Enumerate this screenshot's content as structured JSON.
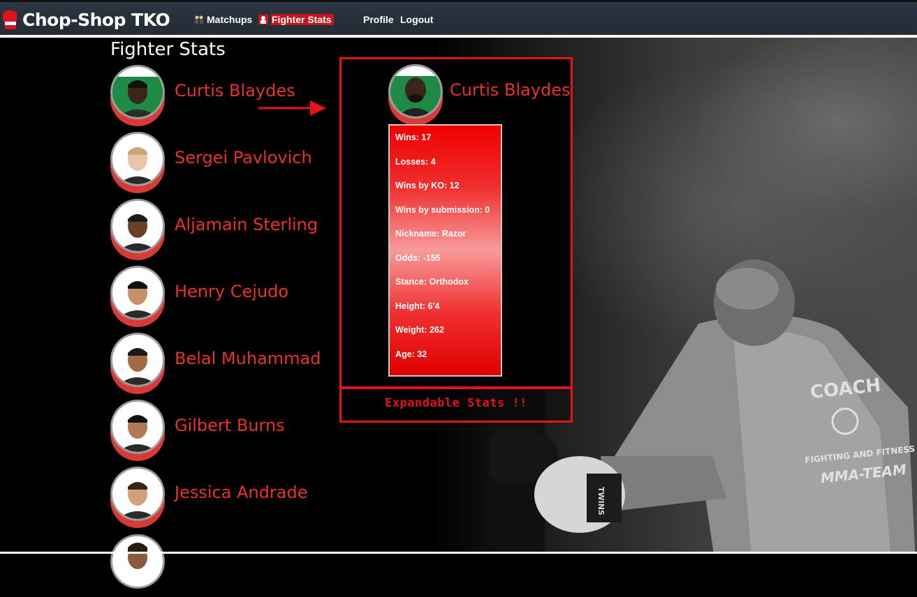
{
  "app": {
    "brand": "Chop-Shop TKO"
  },
  "nav": {
    "matchups": "Matchups",
    "fighter_stats": "Fighter Stats",
    "profile": "Profile",
    "logout": "Logout"
  },
  "page": {
    "title": "Fighter Stats"
  },
  "fighters": [
    {
      "name": "Curtis Blaydes"
    },
    {
      "name": "Sergei Pavlovich"
    },
    {
      "name": "Aljamain Sterling"
    },
    {
      "name": "Henry Cejudo"
    },
    {
      "name": "Belal Muhammad"
    },
    {
      "name": "Gilbert Burns"
    },
    {
      "name": "Jessica Andrade"
    }
  ],
  "selected": {
    "name": "Curtis Blaydes",
    "stats": [
      "Wins: 17",
      "Losses: 4",
      "Wins by KO: 12",
      "Wins by submission: 0",
      "Nickname: Razor",
      "Odds: -155",
      "Stance: Orthodox",
      "Height: 6'4",
      "Weight: 262",
      "Age: 32"
    ]
  },
  "annotation": {
    "footer": "Expandable Stats !!"
  },
  "background_art": {
    "jacket_text_1": "COACH",
    "jacket_text_2": "FIGHTING AND FITNESS",
    "jacket_text_3": "MMA-TEAM",
    "glove_text": "TWINS"
  },
  "colors": {
    "accent_red": "#e3141a",
    "name_red": "#e8322c",
    "navbar": "#2c3541"
  }
}
